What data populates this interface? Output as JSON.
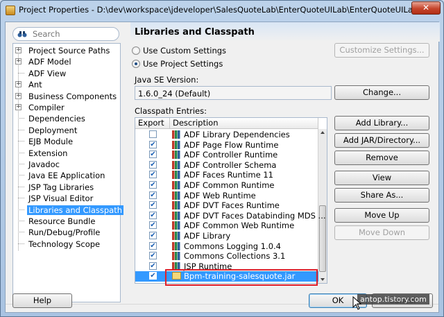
{
  "window": {
    "title": "Project Properties - D:\\dev\\workspace\\jdeveloper\\SalesQuoteLab\\EnterQuoteUILab\\EnterQuoteUILab.jpr",
    "close_label": "✕"
  },
  "search": {
    "placeholder": "Search"
  },
  "tree": {
    "items": [
      {
        "label": "Project Source Paths",
        "expandable": true
      },
      {
        "label": "ADF Model",
        "expandable": true
      },
      {
        "label": "ADF View",
        "expandable": false
      },
      {
        "label": "Ant",
        "expandable": true
      },
      {
        "label": "Business Components",
        "expandable": true
      },
      {
        "label": "Compiler",
        "expandable": true
      },
      {
        "label": "Dependencies",
        "expandable": false
      },
      {
        "label": "Deployment",
        "expandable": false
      },
      {
        "label": "EJB Module",
        "expandable": false
      },
      {
        "label": "Extension",
        "expandable": false
      },
      {
        "label": "Javadoc",
        "expandable": false
      },
      {
        "label": "Java EE Application",
        "expandable": false
      },
      {
        "label": "JSP Tag Libraries",
        "expandable": false
      },
      {
        "label": "JSP Visual Editor",
        "expandable": false
      },
      {
        "label": "Libraries and Classpath",
        "expandable": false,
        "selected": true
      },
      {
        "label": "Resource Bundle",
        "expandable": false
      },
      {
        "label": "Run/Debug/Profile",
        "expandable": false
      },
      {
        "label": "Technology Scope",
        "expandable": false
      }
    ]
  },
  "main": {
    "title": "Libraries and Classpath",
    "use_custom_settings": "Use Custom Settings",
    "use_project_settings": "Use Project Settings",
    "customize_settings": "Customize Settings...",
    "java_se_version_label": "Java SE Version:",
    "java_se_version_value": "1.6.0_24 (Default)",
    "change_button": "Change...",
    "classpath_entries_label": "Classpath Entries:",
    "columns": {
      "export": "Export",
      "description": "Description"
    },
    "entries": [
      {
        "description": "ADF Library Dependencies",
        "exported": false,
        "icon": "library-icon"
      },
      {
        "description": "ADF Page Flow Runtime",
        "exported": true,
        "icon": "library-icon"
      },
      {
        "description": "ADF Controller Runtime",
        "exported": true,
        "icon": "library-icon"
      },
      {
        "description": "ADF Controller Schema",
        "exported": true,
        "icon": "library-icon"
      },
      {
        "description": "ADF Faces Runtime 11",
        "exported": true,
        "icon": "library-icon"
      },
      {
        "description": "ADF Common Runtime",
        "exported": true,
        "icon": "library-icon"
      },
      {
        "description": "ADF Web Runtime",
        "exported": true,
        "icon": "library-icon"
      },
      {
        "description": "ADF DVT Faces Runtime",
        "exported": true,
        "icon": "library-icon"
      },
      {
        "description": "ADF DVT Faces Databinding MDS ...",
        "exported": true,
        "icon": "library-icon"
      },
      {
        "description": "ADF Common Web Runtime",
        "exported": true,
        "icon": "library-icon"
      },
      {
        "description": "ADF Library",
        "exported": true,
        "icon": "library-icon"
      },
      {
        "description": "Commons Logging 1.0.4",
        "exported": true,
        "icon": "library-icon"
      },
      {
        "description": "Commons Collections 3.1",
        "exported": true,
        "icon": "library-icon"
      },
      {
        "description": "JSP Runtime",
        "exported": true,
        "icon": "library-icon"
      },
      {
        "description": "Bpm-training-salesquote.jar",
        "exported": true,
        "icon": "jar-icon",
        "selected": true
      }
    ],
    "buttons": {
      "add_library": "Add Library...",
      "add_jar": "Add JAR/Directory...",
      "remove": "Remove",
      "view": "View",
      "share_as": "Share As...",
      "move_up": "Move Up",
      "move_down": "Move Down"
    }
  },
  "footer": {
    "help": "Help",
    "ok": "OK",
    "cancel": "Cancel",
    "watermark": "antop.tistory.com"
  },
  "colors": {
    "selection": "#3399ff",
    "highlight_box": "#e0202a",
    "titlebar": "#bcd2ea"
  }
}
